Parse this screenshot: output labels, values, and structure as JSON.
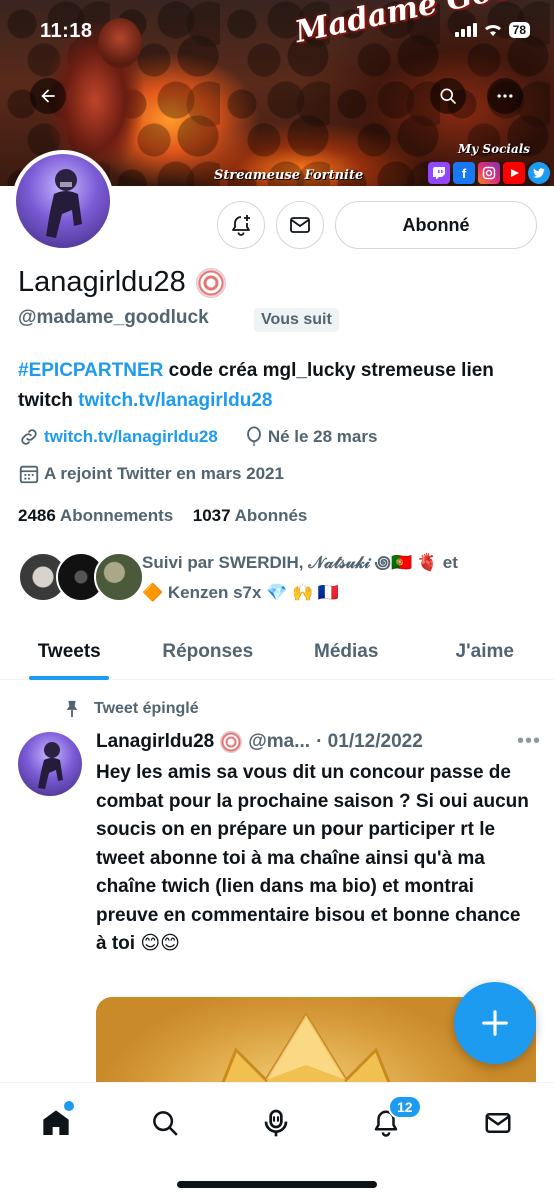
{
  "status_bar": {
    "time": "11:18",
    "battery": "78"
  },
  "banner": {
    "title": "Madame Good Luck",
    "subtitle": "Streameuse Fortnite",
    "socials_label": "My Socials",
    "socials": [
      "twitch-icon",
      "facebook-icon",
      "instagram-icon",
      "youtube-icon",
      "twitter-icon"
    ]
  },
  "profile": {
    "display_name": "Lanagirldu28",
    "handle": "@madame_goodluck",
    "follows_you": "Vous suit",
    "follow_button": "Abonné",
    "bio": {
      "hashtag": "#EPICPARTNER",
      "text": " code créa mgl_lucky stremeuse lien twitch ",
      "link": "twitch.tv/lanagirldu28"
    },
    "website": "twitch.tv/lanagirldu28",
    "birthday": "Né le 28 mars",
    "joined": "A rejoint Twitter en mars 2021",
    "following_count": "2486",
    "following_label": " Abonnements",
    "followers_count": "1037",
    "followers_label": " Abonnés",
    "followed_by": {
      "prefix": "Suivi par ",
      "names": "SWERDIH, 𝒩𝒶𝓉𝓈𝓊𝓀𝒾 ꩜🇵🇹 🫀",
      "conj": " et",
      "last": "🔶 Kenzen s7x 💎 🙌 🇫🇷"
    }
  },
  "tabs": [
    "Tweets",
    "Réponses",
    "Médias",
    "J'aime"
  ],
  "tweet": {
    "pinned_label": "Tweet épinglé",
    "name": "Lanagirldu28",
    "handle": "@ma...",
    "date": "· 01/12/2022",
    "body": "Hey les amis sa vous dit un concour passe de combat pour la prochaine saison ? Si oui aucun soucis on en prépare un pour participer rt le tweet abonne toi à ma chaîne ainsi qu'à ma chaîne twich (lien dans ma bio) et montrai preuve en commentaire bisou et bonne chance à toi 😊😊"
  },
  "bottom_nav": {
    "notifications_badge": "12"
  },
  "colors": {
    "accent": "#1d9bf0",
    "text": "#0f1419",
    "muted": "#536471"
  }
}
